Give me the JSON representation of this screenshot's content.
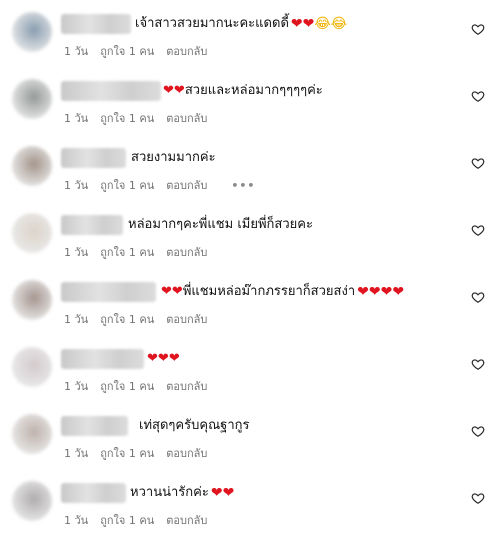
{
  "labels": {
    "time": "1 วัน",
    "likes": "ถูกใจ 1 คน",
    "reply": "ตอบกลับ",
    "more": "•••"
  },
  "comments": [
    {
      "text": "เจ้าสาวสวยมากนะคะแดดดี้",
      "emoji": "❤️❤️😂😂",
      "show_likes": true,
      "show_more": false,
      "avatar_color": "#7d93a8"
    },
    {
      "text": "❤️❤️สวยและหล่อมากๆๆๆๆค่ะ",
      "emoji": "",
      "show_likes": true,
      "show_more": false,
      "avatar_color": "#8a8f8e"
    },
    {
      "text": "สวยงามมากค่ะ",
      "emoji": "",
      "show_likes": true,
      "show_more": true,
      "avatar_color": "#9a8a80"
    },
    {
      "text": "หล่อมากๆคะพี่แชม เมียพี่ก็สวยคะ",
      "emoji": "",
      "show_likes": true,
      "show_more": false,
      "avatar_color": "#d8cfc4"
    },
    {
      "text": "❤️❤️พี่แชมหล่อม๊ากภรรยาก็สวยสง่า",
      "emoji": "❤️❤️❤️❤️",
      "show_likes": true,
      "show_more": false,
      "avatar_color": "#9c8b84"
    },
    {
      "text": "❤️❤️❤️",
      "emoji": "",
      "show_likes": false,
      "show_more": false,
      "avatar_color": "#cfc6c8"
    },
    {
      "text": "เท่สุดๆครับคุณฐากูร",
      "emoji": "",
      "show_likes": false,
      "show_more": false,
      "avatar_color": "#b8aaa2"
    },
    {
      "text": "หวานน่ารักค่ะ",
      "emoji": "❤️❤️",
      "show_likes": true,
      "show_more": false,
      "avatar_color": "#a8a4a6"
    }
  ],
  "colors": {
    "meta": "#737373",
    "heart": "#e0141e",
    "icon": "#262626"
  },
  "icons": {
    "like": "heart-outline-icon"
  }
}
